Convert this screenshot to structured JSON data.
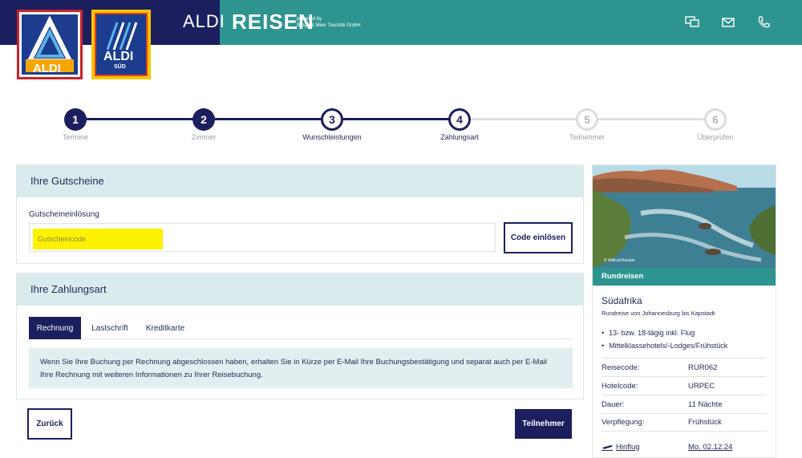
{
  "header": {
    "aldi_text": "ALDI",
    "reisen_text": "REISEN",
    "powered_line1": "powered by",
    "powered_line2": "Berge & Meer Touristik GmbH",
    "logo_aldi_text": "ALDI",
    "logo_sud_text": "ALDI",
    "logo_sud_sub": "SÜD",
    "icons": [
      "chat-icon",
      "mail-icon",
      "phone-icon"
    ]
  },
  "stepper": {
    "steps": [
      {
        "number": "1",
        "label": "Termine",
        "state": "done"
      },
      {
        "number": "2",
        "label": "Zimmer",
        "state": "done"
      },
      {
        "number": "3",
        "label": "Wunschleistungen",
        "state": "current"
      },
      {
        "number": "4",
        "label": "Zahlungsart",
        "state": "current"
      },
      {
        "number": "5",
        "label": "Teilnehmer",
        "state": "todo"
      },
      {
        "number": "6",
        "label": "Überprüfen",
        "state": "todo"
      }
    ]
  },
  "voucher": {
    "title": "Ihre Gutscheine",
    "label": "Gutscheineinlösung",
    "placeholder": "Gutscheincode",
    "button": "Code einlösen"
  },
  "payment": {
    "title": "Ihre Zahlungsart",
    "tabs": [
      "Rechnung",
      "Lastschrift",
      "Kreditkarte"
    ],
    "active_tab": "Rechnung",
    "info_line1": "Wenn Sie Ihre Buchung per Rechnung abgeschlossen haben, erhalten Sie in Kürze per E-Mail Ihre Buchungsbestätigung und separat auch per E-Mail",
    "info_line2": "Ihre Rechnung mit weiteren Informationen zu Ihrer Reisebuchung."
  },
  "actions": {
    "back": "Zurück",
    "next": "Teilnehmer"
  },
  "sidebar": {
    "photo_credit": "© Wiltrud Rassler",
    "category": "Rundreisen",
    "title": "Südafrika",
    "subtitle": "Rundreise von Johannesburg bis Kapstadt",
    "bullets": [
      "13- bzw. 18-tägig inkl. Flug",
      "Mittelklassehotels/-Lodges/Frühstück"
    ],
    "facts": [
      {
        "key": "Reisecode:",
        "value": "RUR062"
      },
      {
        "key": "Hotelcode:",
        "value": "URPEC"
      },
      {
        "key": "Dauer:",
        "value": "11 Nächte"
      },
      {
        "key": "Verpflegung:",
        "value": "Frühstück"
      }
    ],
    "flight_label": "Hinflug",
    "flight_date": "Mo. 02.12.24"
  },
  "colors": {
    "navy": "#1b1f5e",
    "teal": "#2e9490",
    "panel_head": "#d9ebec",
    "highlight": "#fff200"
  }
}
